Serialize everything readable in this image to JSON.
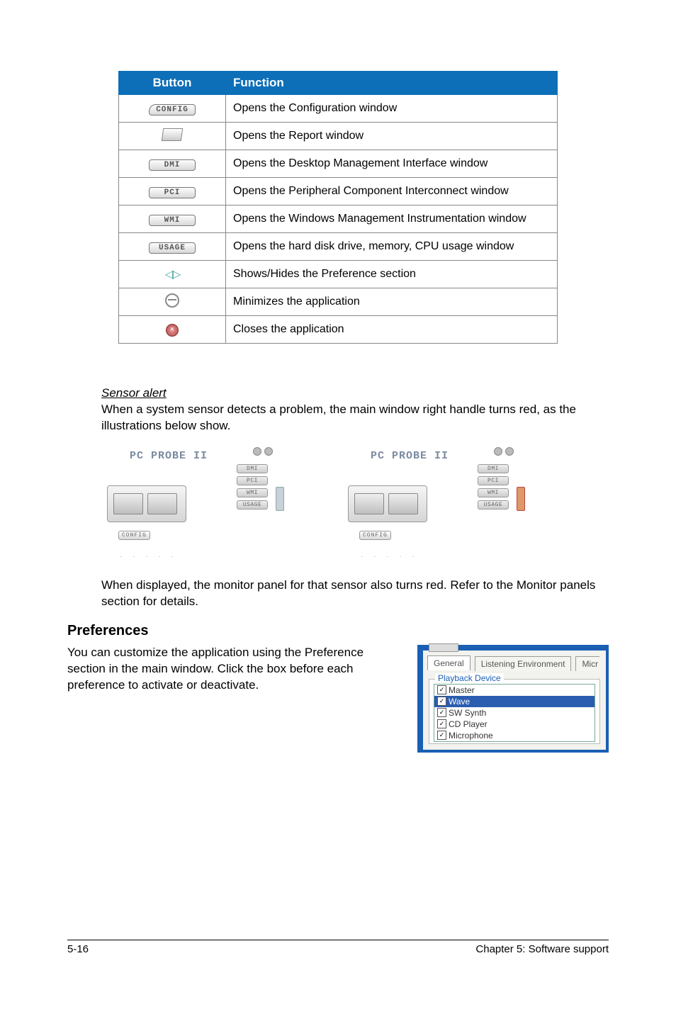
{
  "table": {
    "headers": {
      "button": "Button",
      "function": "Function"
    },
    "rows": [
      {
        "icon": "CONFIG",
        "desc": "Opens the Configuration window"
      },
      {
        "icon": "report",
        "desc": "Opens the Report window"
      },
      {
        "icon": "DMI",
        "desc": "Opens the Desktop Management Interface window"
      },
      {
        "icon": "PCI",
        "desc": "Opens the Peripheral Component Interconnect window"
      },
      {
        "icon": "WMI",
        "desc": "Opens the Windows Management Instrumentation window"
      },
      {
        "icon": "USAGE",
        "desc": "Opens the hard disk drive, memory, CPU usage window"
      },
      {
        "icon": "arrows",
        "desc": "Shows/Hides the Preference section"
      },
      {
        "icon": "minimize",
        "desc": "Minimizes the application"
      },
      {
        "icon": "close",
        "desc": "Closes the application"
      }
    ]
  },
  "sensor": {
    "heading": "Sensor alert",
    "para1": "When a system sensor detects a problem, the main window right handle turns red, as the illustrations below show.",
    "para2": "When displayed, the monitor panel for that sensor also turns red. Refer to the Monitor panels section for details.",
    "widget_title": "PC PROBE II",
    "labels": {
      "dmi": "DMI",
      "pci": "PCI",
      "wmi": "WMI",
      "usage": "USAGE",
      "config": "CONFIG"
    }
  },
  "prefs": {
    "heading": "Preferences",
    "text": "You can customize the application using the Preference section in the main window. Click the box before each preference to activate or deactivate.",
    "tabs": {
      "general": "General",
      "listening": "Listening Environment",
      "mic": "Micr"
    },
    "group": "Playback Device",
    "items": [
      "Master",
      "Wave",
      "SW Synth",
      "CD Player",
      "Microphone"
    ]
  },
  "footer": {
    "left": "5-16",
    "right": "Chapter 5: Software support"
  }
}
